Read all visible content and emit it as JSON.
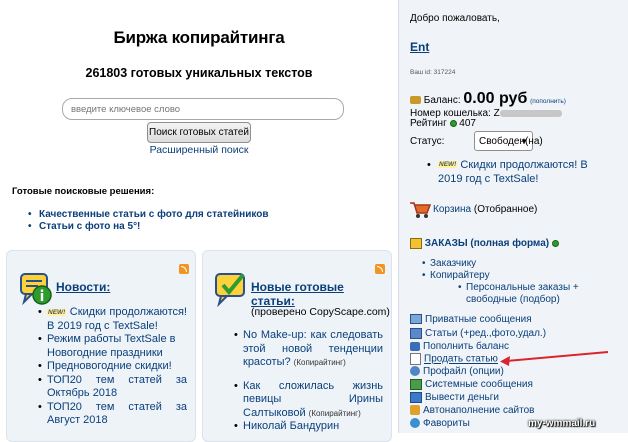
{
  "main": {
    "title": "Биржа копирайтинга",
    "subtitle": "261803 готовых уникальных текстов",
    "search": {
      "placeholder": "введите ключевое слово",
      "button": "Поиск готовых статей",
      "advanced": "Расширенный поиск"
    },
    "ready": {
      "heading": "Готовые поисковые решения:",
      "items": [
        "Качественные статьи с фото для статейников",
        "Статьи с фото на 5°!"
      ]
    }
  },
  "news_panel": {
    "title": "Новости:",
    "new_badge": "NEW!",
    "items": [
      "Скидки продолжаются! В 2019 год с TextSale!",
      "Режим работы TextSale в Новогодние праздники",
      "Предновогодние скидки!",
      "ТОП20 тем статей за Октябрь 2018",
      "ТОП20 тем статей за Август 2018"
    ]
  },
  "articles_panel": {
    "title": "Новые готовые статьи:",
    "note": "(проверено CopyScape.com)",
    "tag": "(Копирайтинг)",
    "items": [
      "No Make-up: как следовать этой новой тенденции красоты?",
      "Как сложилась жизнь певицы Ирины Салтыковой",
      "Николай Бандурин"
    ]
  },
  "sidebar": {
    "welcome": "Добро пожаловать,",
    "username": "Ent",
    "wallet_id_label": "Ваш id: 317224",
    "balance_label": "Баланс:",
    "balance_value": "0.00 руб",
    "topup_small": "(пополнить)",
    "wallet_label": "Номер кошелька: Z",
    "rating_label": "Рейтинг",
    "rating_value": "407",
    "status_label": "Статус:",
    "status_value": "Свободен(на)",
    "news_badge": "NEW!",
    "news_text": "Скидки продолжаются! В 2019 год с TextSale!",
    "cart_label": "Корзина",
    "cart_suffix": "(Отобранное)",
    "orders_label": "ЗАКАЗЫ (полная форма)",
    "orders_items": [
      "Заказчику",
      "Копирайтеру"
    ],
    "orders_sub": "Персональные заказы + свободные (подбор)",
    "menu": [
      {
        "icon": "message-icon",
        "label": "Приватные сообщения"
      },
      {
        "icon": "article-icon",
        "label": "Статьи (+ред.,фото,удал.)"
      },
      {
        "icon": "wallet-icon",
        "label": "Пополнить баланс"
      },
      {
        "icon": "sell-icon",
        "label": "Продать статью"
      },
      {
        "icon": "profile-icon",
        "label": "Профайл (опции)"
      },
      {
        "icon": "system-icon",
        "label": "Системные сообщения"
      },
      {
        "icon": "withdraw-icon",
        "label": "Вывести деньги"
      },
      {
        "icon": "autofill-icon",
        "label": "Автонаполнение сайтов"
      },
      {
        "icon": "favorites-icon",
        "label": "Фавориты"
      }
    ]
  },
  "watermark": "my-wmmail.ru",
  "colors": {
    "link": "#0a3f7a",
    "panel_bg": "#eef3f8",
    "sidebar_bg": "#f0f4f8",
    "arrow": "#d8262c"
  }
}
